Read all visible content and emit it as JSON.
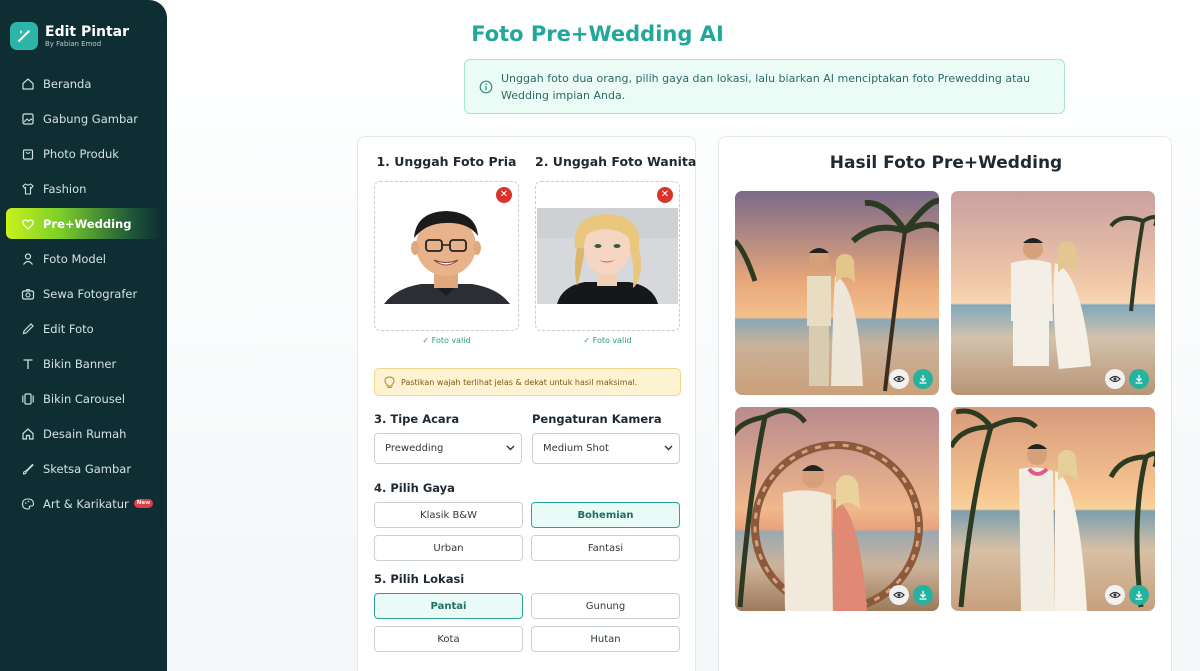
{
  "brand": {
    "title": "Edit Pintar",
    "subtitle": "By Fabian Emod"
  },
  "sidebar": {
    "items": [
      {
        "label": "Beranda",
        "icon": "home-icon"
      },
      {
        "label": "Gabung Gambar",
        "icon": "image-icon"
      },
      {
        "label": "Photo Produk",
        "icon": "bag-icon"
      },
      {
        "label": "Fashion",
        "icon": "shirt-icon"
      },
      {
        "label": "Pre+Wedding",
        "icon": "heart-icon",
        "active": true
      },
      {
        "label": "Foto Model",
        "icon": "user-icon"
      },
      {
        "label": "Sewa Fotografer",
        "icon": "camera-icon"
      },
      {
        "label": "Edit Foto",
        "icon": "pencil-icon"
      },
      {
        "label": "Bikin Banner",
        "icon": "text-icon"
      },
      {
        "label": "Bikin Carousel",
        "icon": "carousel-icon"
      },
      {
        "label": "Desain Rumah",
        "icon": "house-icon"
      },
      {
        "label": "Sketsa Gambar",
        "icon": "brush-icon"
      },
      {
        "label": "Art & Karikatur",
        "icon": "palette-icon",
        "badge": "New"
      }
    ]
  },
  "page": {
    "title": "Foto Pre+Wedding AI",
    "info": "Unggah foto dua orang, pilih gaya dan lokasi, lalu biarkan AI menciptakan foto Prewedding atau Wedding impian Anda."
  },
  "upload": {
    "male_title": "1. Unggah Foto Pria",
    "female_title": "2. Unggah Foto Wanita",
    "male_valid": "✓ Foto valid",
    "female_valid": "✓ Foto valid",
    "remove_symbol": "✕"
  },
  "tip": "Pastikan wajah terlihat jelas & dekat untuk hasil maksimal.",
  "event": {
    "label": "3. Tipe Acara",
    "value": "Prewedding"
  },
  "camera": {
    "label": "Pengaturan Kamera",
    "value": "Medium Shot"
  },
  "style": {
    "label": "4. Pilih Gaya",
    "options": [
      "Klasik B&W",
      "Bohemian",
      "Urban",
      "Fantasi"
    ],
    "selected": "Bohemian"
  },
  "location": {
    "label": "5. Pilih Lokasi",
    "options": [
      "Pantai",
      "Gunung",
      "Kota",
      "Hutan"
    ],
    "selected": "Pantai"
  },
  "results": {
    "title": "Hasil Foto Pre+Wedding",
    "count": 4
  },
  "colors": {
    "accent": "#22a79b",
    "sidebar": "#0f2e33",
    "active_nav": "#c8f21a",
    "download": "#25b39f",
    "remove": "#d9342b"
  }
}
